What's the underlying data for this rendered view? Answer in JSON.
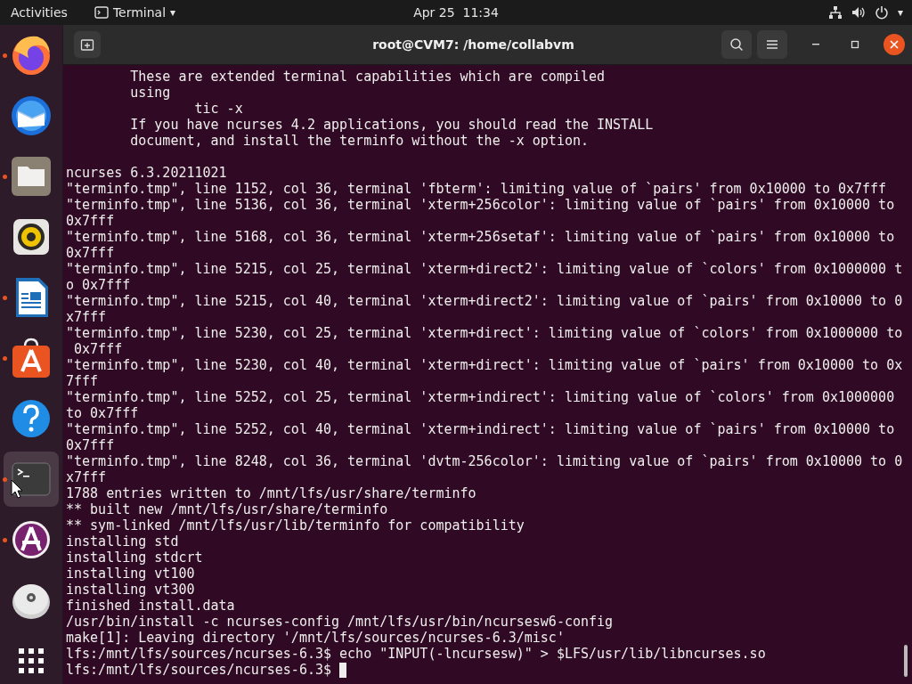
{
  "top_bar": {
    "activities": "Activities",
    "app_menu": {
      "label": "Terminal",
      "caret": "▾"
    },
    "clock": "Apr 25  11:34",
    "status_caret": "▾"
  },
  "dock": [
    {
      "kind": "browser",
      "running": true,
      "selected": false
    },
    {
      "kind": "mail",
      "running": false,
      "selected": false
    },
    {
      "kind": "files",
      "running": true,
      "selected": false
    },
    {
      "kind": "music",
      "running": false,
      "selected": false
    },
    {
      "kind": "document",
      "running": true,
      "selected": false
    },
    {
      "kind": "store",
      "running": true,
      "selected": false
    },
    {
      "kind": "help",
      "running": false,
      "selected": false
    },
    {
      "kind": "terminal",
      "running": true,
      "selected": true
    },
    {
      "kind": "installer",
      "running": true,
      "selected": false
    },
    {
      "kind": "disc",
      "running": false,
      "selected": false
    },
    {
      "kind": "apps",
      "running": false,
      "selected": false
    }
  ],
  "window": {
    "title": "root@CVM7: /home/collabvm"
  },
  "terminal": {
    "blocks": [
      [
        "        These are extended terminal capabilities which are compiled",
        "        using",
        "                tic -x",
        "        If you have ncurses 4.2 applications, you should read the INSTALL",
        "        document, and install the terminfo without the -x option."
      ],
      [
        "ncurses 6.3.20211021",
        "\"terminfo.tmp\", line 1152, col 36, terminal 'fbterm': limiting value of `pairs' from 0x10000 to 0x7fff",
        "\"terminfo.tmp\", line 5136, col 36, terminal 'xterm+256color': limiting value of `pairs' from 0x10000 to",
        "0x7fff",
        "\"terminfo.tmp\", line 5168, col 36, terminal 'xterm+256setaf': limiting value of `pairs' from 0x10000 to",
        "0x7fff",
        "\"terminfo.tmp\", line 5215, col 25, terminal 'xterm+direct2': limiting value of `colors' from 0x1000000 t",
        "o 0x7fff",
        "\"terminfo.tmp\", line 5215, col 40, terminal 'xterm+direct2': limiting value of `pairs' from 0x10000 to 0",
        "x7fff",
        "\"terminfo.tmp\", line 5230, col 25, terminal 'xterm+direct': limiting value of `colors' from 0x1000000 to",
        " 0x7fff",
        "\"terminfo.tmp\", line 5230, col 40, terminal 'xterm+direct': limiting value of `pairs' from 0x10000 to 0x",
        "7fff",
        "\"terminfo.tmp\", line 5252, col 25, terminal 'xterm+indirect': limiting value of `colors' from 0x1000000",
        "to 0x7fff",
        "\"terminfo.tmp\", line 5252, col 40, terminal 'xterm+indirect': limiting value of `pairs' from 0x10000 to",
        "0x7fff",
        "\"terminfo.tmp\", line 8248, col 36, terminal 'dvtm-256color': limiting value of `pairs' from 0x10000 to 0",
        "x7fff",
        "1788 entries written to /mnt/lfs/usr/share/terminfo",
        "** built new /mnt/lfs/usr/share/terminfo",
        "** sym-linked /mnt/lfs/usr/lib/terminfo for compatibility",
        "installing std",
        "installing stdcrt",
        "installing vt100",
        "installing vt300",
        "finished install.data",
        "/usr/bin/install -c ncurses-config /mnt/lfs/usr/bin/ncursesw6-config",
        "make[1]: Leaving directory '/mnt/lfs/sources/ncurses-6.3/misc'",
        "lfs:/mnt/lfs/sources/ncurses-6.3$ echo \"INPUT(-lncursesw)\" > $LFS/usr/lib/libncurses.so"
      ]
    ],
    "prompt": "lfs:/mnt/lfs/sources/ncurses-6.3$ "
  }
}
